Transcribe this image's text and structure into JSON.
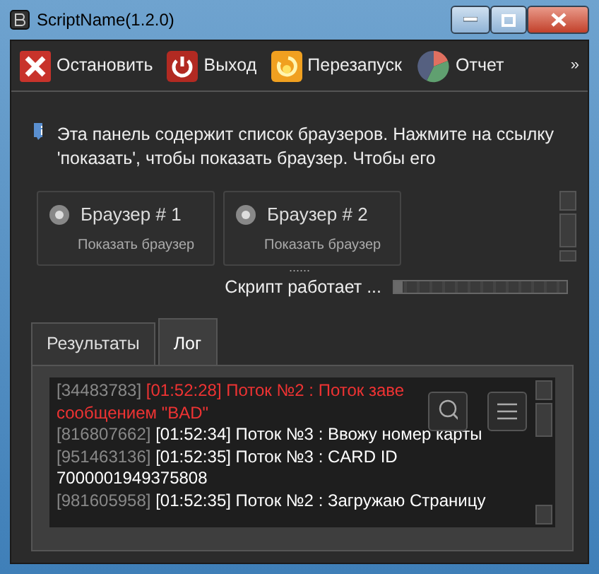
{
  "window": {
    "title": "ScriptName(1.2.0)"
  },
  "toolbar": [
    {
      "kind": "stop",
      "label": "Остановить"
    },
    {
      "kind": "exit",
      "label": "Выход"
    },
    {
      "kind": "restart",
      "label": "Перезапуск"
    },
    {
      "kind": "report",
      "label": "Отчет"
    }
  ],
  "toolbar_overflow": "»",
  "info": "Эта панель содержит список браузеров. Нажмите на ссылку 'показать', чтобы показать браузер. Чтобы его",
  "browsers": [
    {
      "title": "Браузер # 1",
      "link": "Показать браузер"
    },
    {
      "title": "Браузер # 2",
      "link": "Показать браузер"
    }
  ],
  "splitter": "......",
  "status": "Скрипт работает ...",
  "progress": {
    "level": 0.05
  },
  "tabs": [
    {
      "label": "Результаты",
      "selected": false
    },
    {
      "label": "Лог",
      "selected": true
    }
  ],
  "log": [
    {
      "kind": "entry",
      "id": "[34483783]",
      "time": "[01:52:28]",
      "text": "Поток №2 : Поток заве",
      "error": true
    },
    {
      "kind": "continuation",
      "text": "сообщением \"BAD\"",
      "error": true
    },
    {
      "kind": "entry",
      "id": "[816807662]",
      "time": "[01:52:34]",
      "text": "Поток №3 : Ввожу номер карты",
      "error": false
    },
    {
      "kind": "entry",
      "id": "[951463136]",
      "time": "[01:52:35]",
      "text": "Поток №3 : CARD ID 7000001949375808",
      "error": false
    },
    {
      "kind": "entry",
      "id": "[981605958]",
      "time": "[01:52:35]",
      "text": "Поток №2 : Загружаю Страницу",
      "error": false
    }
  ]
}
